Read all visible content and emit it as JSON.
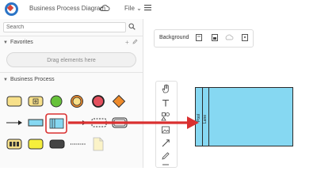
{
  "app": {
    "title": "Business Process Diagram",
    "file_menu_label": "File",
    "file_menu_caret": "⌄"
  },
  "sidebar": {
    "search": {
      "placeholder": "Search",
      "value": ""
    },
    "favorites": {
      "label": "Favorites",
      "add_symbol": "+",
      "dropzone_text": "Drag elements here"
    },
    "business_process": {
      "label": "Business Process",
      "shape_icons": [
        "rounded-task-icon",
        "subprocess-icon",
        "start-event-icon",
        "intermediate-event-icon",
        "end-event-icon",
        "gateway-icon",
        "sequence-flow-icon",
        "data-object-icon",
        "pool-lane-icon",
        "message-flow-icon",
        "group-icon",
        "transaction-icon",
        "conveyor-icon",
        "yellow-task-icon",
        "dark-task-icon",
        "dotted-association-icon",
        "document-icon"
      ]
    }
  },
  "canvas": {
    "background_label": "Background",
    "pool": {
      "pool_label": "Pool",
      "lane_label": "Lane"
    }
  },
  "tools": [
    "hand-icon",
    "text-icon",
    "shapes-icon",
    "image-icon",
    "line-icon",
    "pen-icon",
    "more-icon"
  ],
  "colors": {
    "accent_blue": "#2b74c6",
    "pool_fill": "#86d8f2",
    "highlight_red": "#d93030",
    "task_yellow": "#f7e08a",
    "start_green": "#67c23a",
    "gateway_orange": "#ee8a2a"
  }
}
